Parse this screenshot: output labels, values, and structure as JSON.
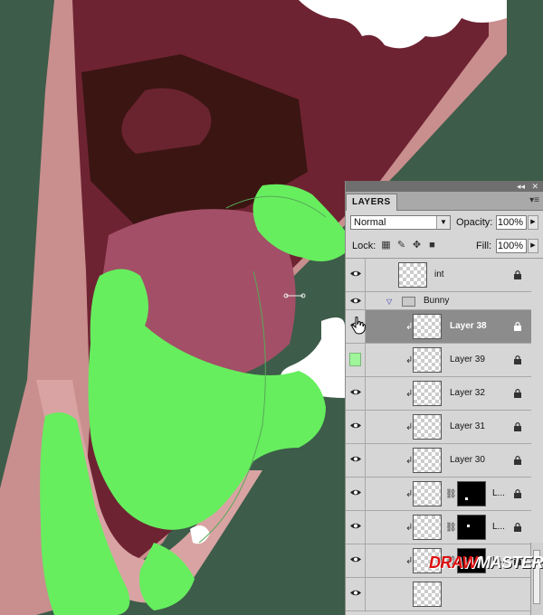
{
  "panel": {
    "tab_label": "LAYERS",
    "blend_mode": "Normal",
    "opacity_label": "Opacity:",
    "opacity_value": "100%",
    "lock_label": "Lock:",
    "fill_label": "Fill:",
    "fill_value": "100%"
  },
  "layers": {
    "top": {
      "name": "int"
    },
    "group": {
      "name": "Bunny"
    },
    "items": [
      {
        "name": "Layer 38"
      },
      {
        "name": "Layer 39"
      },
      {
        "name": "Layer 32"
      },
      {
        "name": "Layer 31"
      },
      {
        "name": "Layer 30"
      },
      {
        "name": "L..."
      },
      {
        "name": "L..."
      },
      {
        "name": "L..."
      }
    ]
  },
  "watermark": {
    "part1": "DRAW",
    "part2": "MASTER.RU"
  },
  "colors": {
    "mask_green": "#66ee5e",
    "panel_bg": "#d6d6d6",
    "selected_row": "#8c8c8c"
  }
}
